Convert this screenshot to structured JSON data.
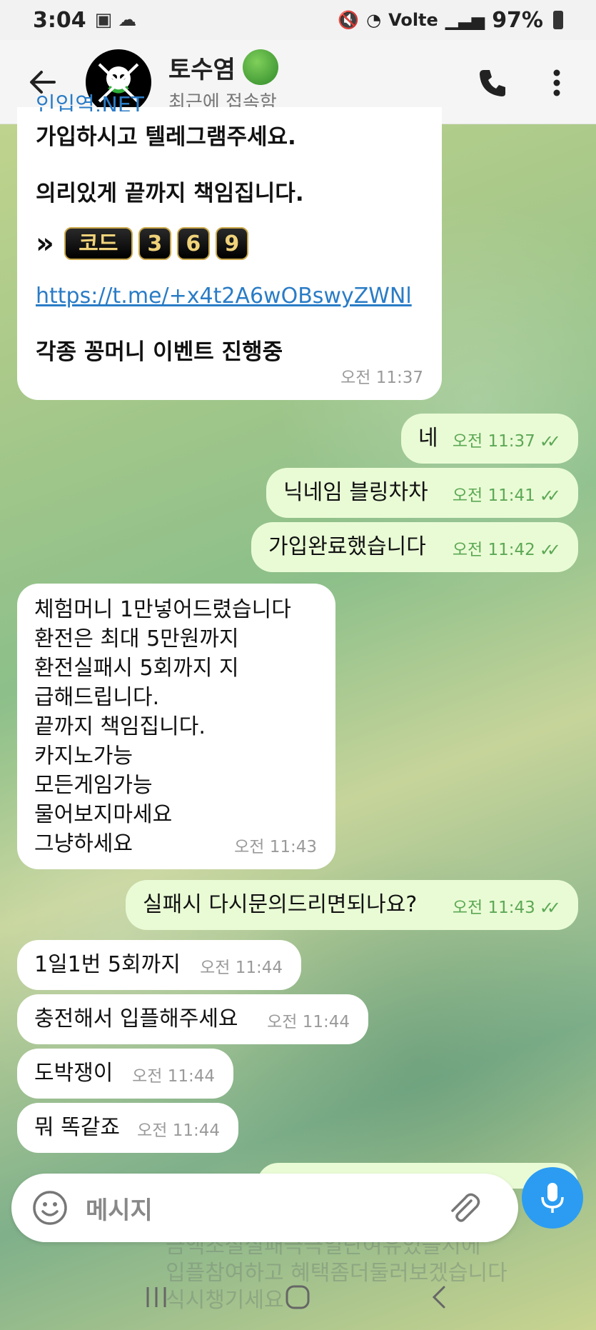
{
  "status_bar": {
    "time": "3:04",
    "right": "Volte",
    "battery": "97%"
  },
  "header": {
    "contact_name": "토수염",
    "status": "최근에 접속함"
  },
  "messages": {
    "m1": {
      "partial_top": "인입역.NET",
      "line1": "가입하시고 텔레그램주세요.",
      "line2": "의리있게 끝까지 책임집니다.",
      "code_label": "코드",
      "code_digits": [
        "3",
        "6",
        "9"
      ],
      "link": "https://t.me/+x4t2A6wOBswyZWNl",
      "line3": "각종 꽁머니 이벤트 진행중",
      "time": "오전 11:37"
    },
    "m2": {
      "text": "네",
      "time": "오전 11:37"
    },
    "m3": {
      "text": "닉네임 블링차차",
      "time": "오전 11:41"
    },
    "m4": {
      "text": "가입완료했습니다",
      "time": "오전 11:42"
    },
    "m5": {
      "lines": [
        "체험머니 1만넣어드렸습니다",
        "환전은 최대 5만원까지",
        "환전실패시 5회까지 지",
        "급해드립니다.",
        "끝까지 책임집니다.",
        "카지노가능",
        "모든게임가능",
        "물어보지마세요",
        "그냥하세요"
      ],
      "time": "오전 11:43"
    },
    "m6": {
      "text": "실패시 다시문의드리면되나요?",
      "time": "오전 11:43"
    },
    "m7": {
      "text": "1일1번 5회까지",
      "time": "오전 11:44"
    },
    "m8": {
      "text": "충전해서 입플해주세요",
      "time": "오전 11:44"
    },
    "m9": {
      "text": "도박쟁이",
      "time": "오전 11:44"
    },
    "m10": {
      "text": "뭐 똑같죠",
      "time": "오전 11:44"
    }
  },
  "input": {
    "placeholder": "메시지"
  },
  "ghost": {
    "lines": [
      "금액조절실패극극일단여유있을시에",
      "입플참여하고 혜택좀더둘러보겠습니다",
      "식시챙기세요"
    ]
  }
}
